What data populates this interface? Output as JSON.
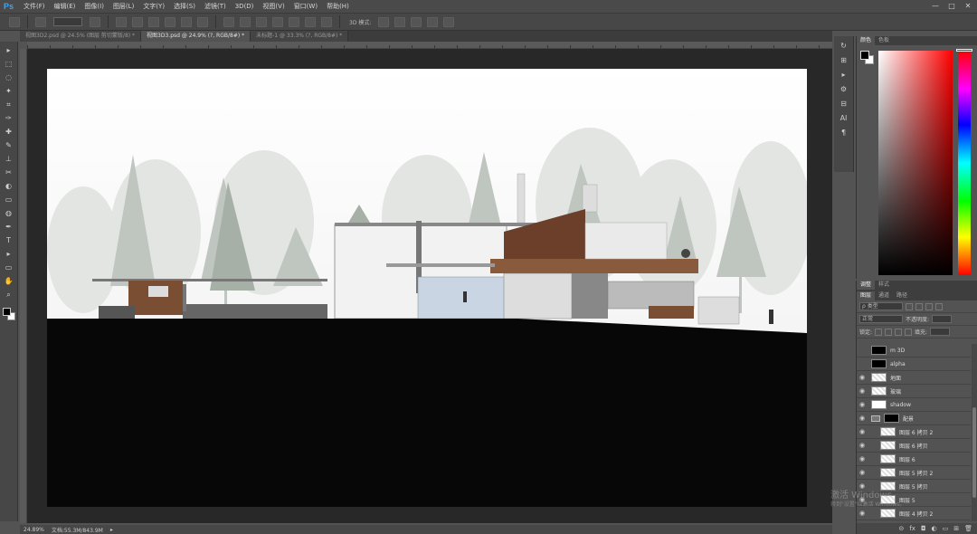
{
  "app": {
    "logo": "Ps"
  },
  "menu": [
    "文件(F)",
    "编辑(E)",
    "图像(I)",
    "图层(L)",
    "文字(Y)",
    "选择(S)",
    "滤镜(T)",
    "3D(D)",
    "视图(V)",
    "窗口(W)",
    "帮助(H)"
  ],
  "window_controls": {
    "minimize": "—",
    "maximize": "□",
    "close": "✕"
  },
  "options": {
    "mode_3d": "3D 模式:"
  },
  "tabs": [
    {
      "label": "视图3D2.psd @ 24.5% (图层 剪切蒙版/8) *",
      "active": false
    },
    {
      "label": "视图3D3.psd @ 24.9% (?, RGB/8#) *",
      "active": true
    },
    {
      "label": "未标题-1 @ 33.3% (?, RGB/8#) *",
      "active": false
    }
  ],
  "tools": [
    "▸",
    "⬚",
    "◌",
    "✦",
    "⌗",
    "✑",
    "✚",
    "✎",
    "⊥",
    "✂",
    "◐",
    "▭",
    "◍",
    "✒",
    "T",
    "▸",
    "▭",
    "✋",
    "⌕"
  ],
  "status": {
    "zoom": "24.89%",
    "doc": "文档:55.3M/843.9M",
    "arrow": "▸"
  },
  "strip_icons": [
    "↻",
    "⊞",
    "▸",
    "⚙",
    "⊟",
    "AI",
    "¶"
  ],
  "color_panel": {
    "tabs": [
      "颜色",
      "色板"
    ]
  },
  "adjust_panel": {
    "tabs": [
      "调整",
      "样式"
    ]
  },
  "layers_panel": {
    "tabs": [
      "图层",
      "通道",
      "路径"
    ],
    "kind": "ρ 类型",
    "mode": "正常",
    "opacity_label": "不透明度:",
    "lock_label": "锁定:",
    "fill_label": "填充:",
    "layers": [
      {
        "name": "m 3D",
        "visible": false,
        "thumb": "dark",
        "indent": false,
        "folder": false
      },
      {
        "name": "alpha",
        "visible": false,
        "thumb": "dark",
        "indent": false,
        "folder": false
      },
      {
        "name": "地面",
        "visible": true,
        "thumb": "checker",
        "indent": false,
        "folder": false
      },
      {
        "name": "玻璃",
        "visible": true,
        "thumb": "checker",
        "indent": false,
        "folder": false
      },
      {
        "name": "shadow",
        "visible": true,
        "thumb": "white",
        "indent": false,
        "folder": false
      },
      {
        "name": "配景",
        "visible": true,
        "thumb": "dark",
        "indent": false,
        "folder": true
      },
      {
        "name": "图层 6 拷贝 2",
        "visible": true,
        "thumb": "checker",
        "indent": true,
        "folder": false
      },
      {
        "name": "图层 6 拷贝",
        "visible": true,
        "thumb": "checker",
        "indent": true,
        "folder": false
      },
      {
        "name": "图层 6",
        "visible": true,
        "thumb": "checker",
        "indent": true,
        "folder": false
      },
      {
        "name": "图层 5 拷贝 2",
        "visible": true,
        "thumb": "checker",
        "indent": true,
        "folder": false
      },
      {
        "name": "图层 5 拷贝",
        "visible": true,
        "thumb": "checker",
        "indent": true,
        "folder": false
      },
      {
        "name": "图层 5",
        "visible": true,
        "thumb": "checker",
        "indent": true,
        "folder": false
      },
      {
        "name": "图层 4 拷贝 2",
        "visible": true,
        "thumb": "checker",
        "indent": true,
        "folder": false
      }
    ],
    "footer_icons": [
      "⊝",
      "fx",
      "◘",
      "◐",
      "▭",
      "⊞",
      "🗑"
    ]
  },
  "watermark": {
    "line1": "激活 Windows",
    "line2": "转到\"设置\"以激活 Windows。"
  }
}
